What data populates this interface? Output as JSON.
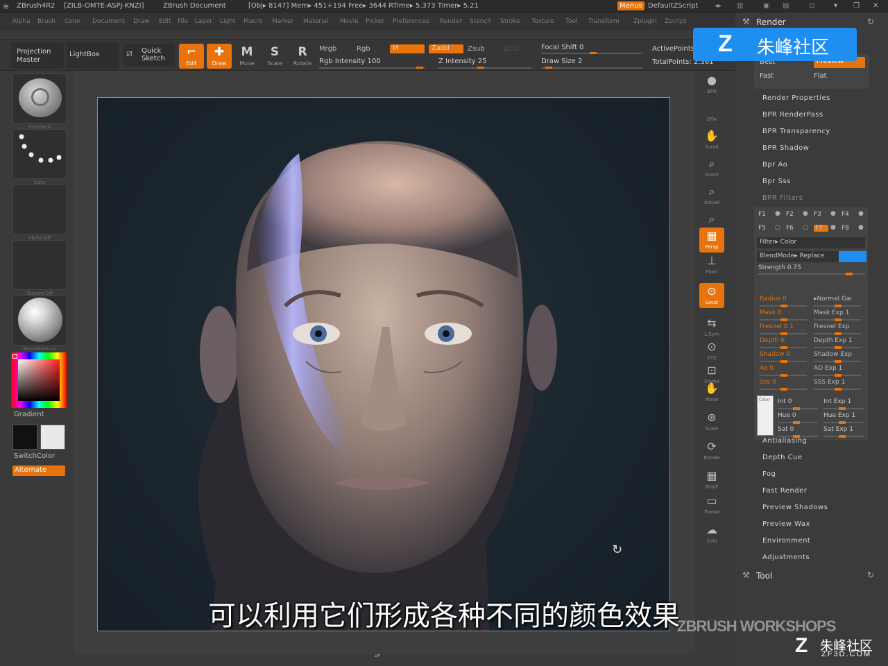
{
  "titlebar": {
    "app": "ZBrush4R2",
    "serial": "[ZILB-OMTE-ASPJ-KNZI]",
    "doc": "ZBrush Document",
    "stats": "[Obj▸ 8147] Mem▸ 451+194  Free▸ 3644  RTime▸ 5.373  Timer▸ 5.21",
    "menus_label": "Menus",
    "script_label": "DefaultZScript"
  },
  "menubar": [
    "Alpha",
    "Brush",
    "Color",
    "Document",
    "Draw",
    "Edit",
    "File",
    "Layer",
    "Light",
    "Macro",
    "Marker",
    "Material",
    "Movie",
    "Picker",
    "Preferences",
    "Render",
    "Stencil",
    "Stroke",
    "Texture",
    "Tool",
    "Transform",
    "Zplugin",
    "Zscript"
  ],
  "toolbar": {
    "projection_master": "Projection Master",
    "lightbox": "LightBox",
    "quick_sketch": "Quick Sketch",
    "edit": "Edit",
    "draw": "Draw",
    "move": "Move",
    "scale": "Scale",
    "rotate": "Rotate",
    "mrgb": "Mrgb",
    "rgb": "Rgb",
    "m": "M",
    "zadd": "Zadd",
    "zsub": "Zsub",
    "zcut": "Zcut",
    "rgb_intensity": "Rgb Intensity 100",
    "z_intensity": "Z Intensity 25",
    "focal_shift": "Focal Shift 0",
    "draw_size": "Draw Size 2",
    "active_points": "ActivePoints:",
    "total_points": "TotalPoints: 2.361"
  },
  "leftshelf": {
    "brush": "Standard",
    "stroke": "Dots",
    "alpha": "Alpha Off",
    "texture": "Texture Off",
    "material": "BasicMaterial",
    "gradient": "Gradient",
    "switch_color": "SwitchColor",
    "alternate": "Alternate"
  },
  "rightshelf": [
    "BPR",
    "SPix",
    "Scroll",
    "Zoom",
    "Actual",
    "AAHalf",
    "Persp",
    "Floor",
    "Local",
    "L.Sym",
    "XYZ",
    "Frame",
    "Move",
    "Scale",
    "Rotate",
    "PolyF",
    "Transp",
    "Solo"
  ],
  "render_panel": {
    "title": "Render",
    "best": "Best",
    "preview": "Preview",
    "fast": "Fast",
    "flat": "Flat",
    "items_top": [
      "Render Properties",
      "BPR RenderPass",
      "BPR Transparency",
      "BPR Shadow",
      "Bpr Ao",
      "Bpr Sss",
      "BPR Filters"
    ],
    "filter_slots": [
      "F1",
      "F2",
      "F3",
      "F4",
      "F5",
      "F6",
      "F7",
      "F8"
    ],
    "filter_color": "Filter▸ Color",
    "blend_mode": "BlendMode▸ Replace",
    "strength": "Strength 0.75",
    "color_swatch_label": "Color",
    "params": [
      [
        "Radius 0",
        "▸Normal Gai"
      ],
      [
        "Mask 0",
        "Mask Exp 1"
      ],
      [
        "Fresnel 0.1",
        "Fresnel Exp"
      ],
      [
        "Depth 0",
        "Depth Exp 1"
      ],
      [
        "Shadow 0",
        "Shadow Exp"
      ],
      [
        "Ao 0",
        "AO Exp 1"
      ],
      [
        "Sss 0",
        "SSS Exp 1"
      ]
    ],
    "params2": [
      [
        "Int 0",
        "Int Exp 1"
      ],
      [
        "Hue 0",
        "Hue Exp 1"
      ],
      [
        "Sat 0",
        "Sat Exp 1"
      ]
    ],
    "items_bottom": [
      "Antialiasing",
      "Depth Cue",
      "Fog",
      "Fast Render",
      "Preview Shadows",
      "Preview Wax",
      "Environment",
      "Adjustments"
    ],
    "tool_title": "Tool"
  },
  "subtitle": "可以利用它们形成各种不同的颜色效果",
  "watermark": {
    "top": "朱峰社区",
    "bottom_cn": "朱峰社区",
    "bottom_en": "ZF3D.COM",
    "workshops": "ZBRUSH WORKSHOPS"
  },
  "colors": {
    "accent": "#e8720c",
    "highlight_blue": "#1e8ef0"
  }
}
